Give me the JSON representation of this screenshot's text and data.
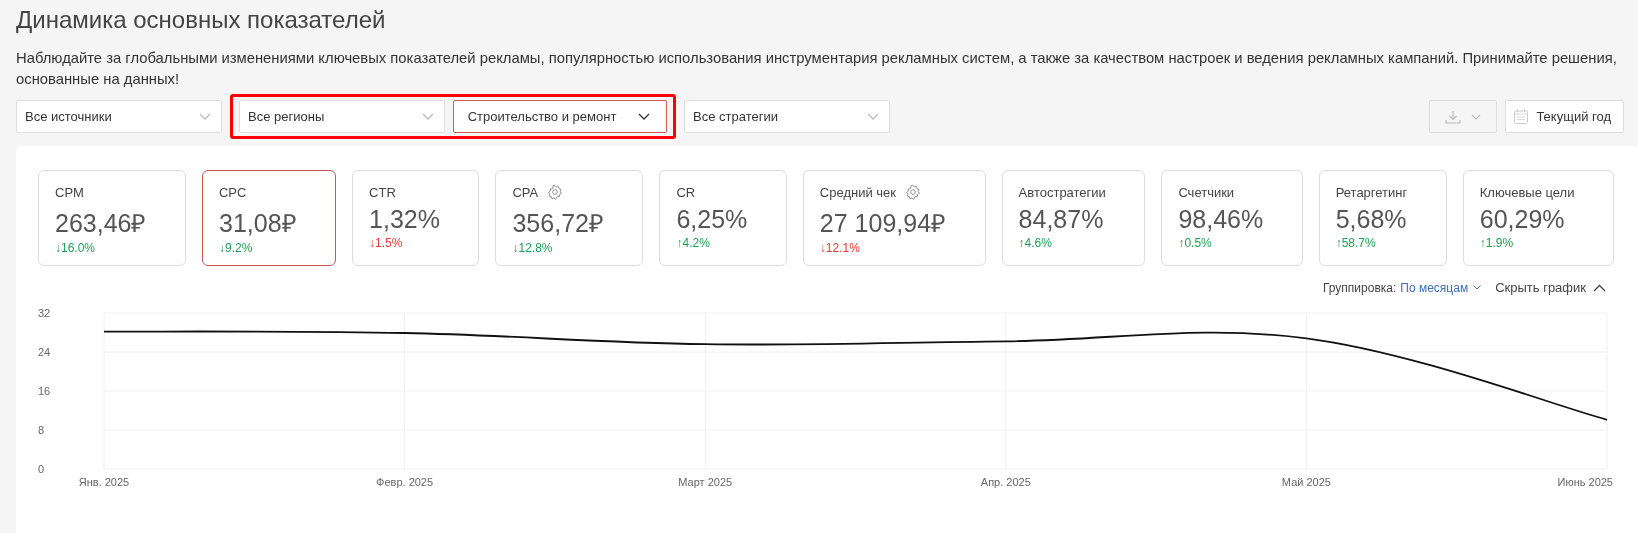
{
  "page": {
    "title": "Динамика основных показателей",
    "description": "Наблюдайте за глобальными изменениями ключевых показателей рекламы, популярностью использования инструментария рекламных систем, а также за качеством настроек и ведения рекламных кампаний. Принимайте решения, основанные на данных!"
  },
  "filters": [
    {
      "kind": "dropdown",
      "label": "Все источники",
      "active": false
    },
    {
      "kind": "highlight",
      "items": [
        {
          "label": "Все регионы",
          "active": false
        },
        {
          "label": "Строительство и ремонт",
          "active": true
        }
      ]
    },
    {
      "kind": "dropdown",
      "label": "Все стратегии",
      "active": false
    }
  ],
  "period_button": {
    "label": "Текущий год"
  },
  "metrics": [
    {
      "name": "CPM",
      "value": "263,46₽",
      "change": "↓16.0%",
      "color": "#1e9e55",
      "settings": false,
      "selected": false
    },
    {
      "name": "CPC",
      "value": "31,08₽",
      "change": "↓9.2%",
      "color": "#1e9e55",
      "settings": false,
      "selected": true
    },
    {
      "name": "CTR",
      "value": "1,32%",
      "change": "↓1.5%",
      "color": "#e53935",
      "settings": false,
      "selected": false
    },
    {
      "name": "CPA",
      "value": "356,72₽",
      "change": "↓12.8%",
      "color": "#1e9e55",
      "settings": true,
      "selected": false
    },
    {
      "name": "CR",
      "value": "6,25%",
      "change": "↑4.2%",
      "color": "#1e9e55",
      "settings": false,
      "selected": false
    },
    {
      "name": "Средний чек",
      "value": "27 109,94₽",
      "change": "↓12.1%",
      "color": "#e53935",
      "settings": true,
      "selected": false
    },
    {
      "name": "Автостратегии",
      "value": "84,87%",
      "change": "↑4.6%",
      "color": "#1e9e55",
      "settings": false,
      "selected": false
    },
    {
      "name": "Счетчики",
      "value": "98,46%",
      "change": "↑0.5%",
      "color": "#1e9e55",
      "settings": false,
      "selected": false
    },
    {
      "name": "Ретаргетинг",
      "value": "5,68%",
      "change": "↑58.7%",
      "color": "#1e9e55",
      "settings": false,
      "selected": false
    },
    {
      "name": "Ключевые цели",
      "value": "60,29%",
      "change": "↑1.9%",
      "color": "#1e9e55",
      "settings": false,
      "selected": false
    }
  ],
  "chart_controls": {
    "grouping_label": "Группировка:",
    "grouping_value": "По месяцам",
    "hide_label": "Скрыть график"
  },
  "chart_data": {
    "type": "line",
    "categories": [
      "Янв. 2025",
      "Февр. 2025",
      "Март 2025",
      "Апр. 2025",
      "Май 2025",
      "Июнь 2025"
    ],
    "series": [
      {
        "color": "#111111",
        "values": [
          28.2,
          27.9,
          25.6,
          26.2,
          26.8,
          10.1
        ]
      }
    ],
    "grid": true,
    "ylim": [
      0,
      32
    ],
    "yticks": [
      0,
      8,
      16,
      24,
      32
    ]
  }
}
